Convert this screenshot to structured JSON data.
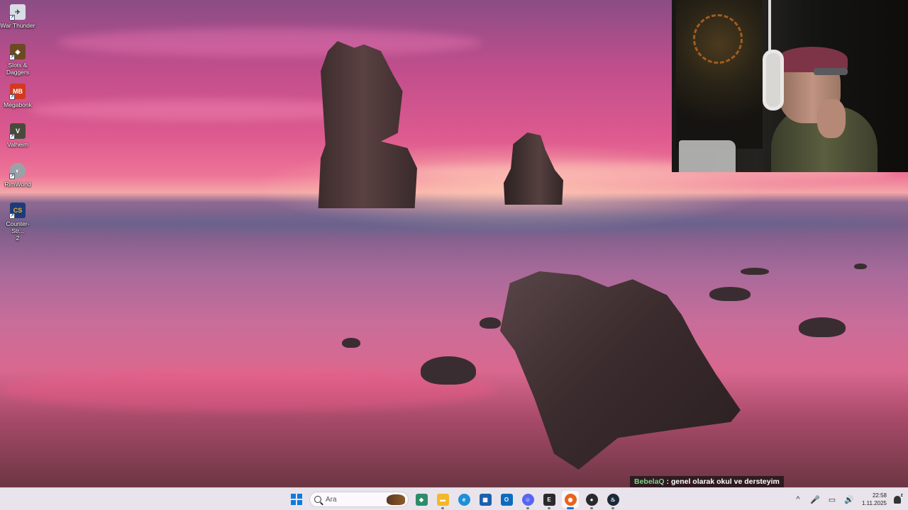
{
  "desktop": {
    "icons": [
      {
        "name": "War Thunder",
        "label": "War Thunder",
        "icon": "war-thunder-icon",
        "color": "#d8dde6",
        "text": "✈"
      },
      {
        "name": "Slots & Daggers",
        "label": "Slots &\nDaggers",
        "icon": "slots-daggers-icon",
        "color": "#6b4a22",
        "text": "◈"
      },
      {
        "name": "Megabonk",
        "label": "Megabonk",
        "icon": "megabonk-icon",
        "color": "#d23a1f",
        "text": "MB"
      },
      {
        "name": "Valheim",
        "label": "Valheim",
        "icon": "valheim-icon",
        "color": "#4a4a3c",
        "text": "V"
      },
      {
        "name": "RimWorld",
        "label": "RimWorld",
        "icon": "rimworld-icon",
        "color": "#9aa2a8",
        "text": "◐"
      },
      {
        "name": "Counter-Strike 2",
        "label": "Counter-Str...\n2",
        "icon": "counter-strike-icon",
        "color": "#1d3b7a",
        "text": "CS"
      }
    ]
  },
  "chat": {
    "username": "BebelaQ",
    "message": " : genel olarak okul ve dersteyim"
  },
  "taskbar": {
    "search_placeholder": "Ara",
    "apps": [
      {
        "name": "copilot",
        "icon": "copilot-icon",
        "color": "#2d8c6a",
        "text": "◆"
      },
      {
        "name": "file-explorer",
        "icon": "folder-icon",
        "color": "#f2b82a",
        "text": "▬"
      },
      {
        "name": "edge",
        "icon": "edge-icon",
        "color": "#1f8fd6",
        "text": "e"
      },
      {
        "name": "microsoft-store",
        "icon": "store-icon",
        "color": "#1c5fae",
        "text": "▦"
      },
      {
        "name": "outlook",
        "icon": "outlook-icon",
        "color": "#0f6cbd",
        "text": "O"
      },
      {
        "name": "discord",
        "icon": "discord-icon",
        "color": "#5865f2",
        "text": "☺"
      },
      {
        "name": "epic-games",
        "icon": "epic-games-icon",
        "color": "#2a2a2a",
        "text": "E"
      },
      {
        "name": "firefox",
        "icon": "firefox-icon",
        "color": "#e8631a",
        "text": "◉"
      },
      {
        "name": "obs",
        "icon": "obs-icon",
        "color": "#2a2a2e",
        "text": "●"
      },
      {
        "name": "steam",
        "icon": "steam-icon",
        "color": "#1b2838",
        "text": "♨"
      }
    ],
    "active_app": "firefox",
    "tray": {
      "chevron": "^",
      "mic": "🎤",
      "network": "▭",
      "volume": "🔊"
    },
    "clock": {
      "time": "22:58",
      "date": "1.11.2025"
    }
  }
}
